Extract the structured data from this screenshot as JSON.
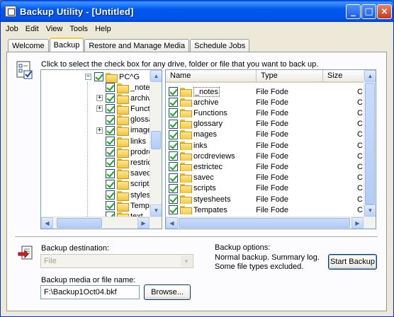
{
  "window": {
    "title": "Backup Utility - [Untitled]",
    "controls": {
      "minimize": "_",
      "maximize": "□",
      "close": "×"
    }
  },
  "menu": [
    "Job",
    "Edit",
    "View",
    "Tools",
    "Help"
  ],
  "tabs": [
    {
      "label": "Welcome",
      "active": false
    },
    {
      "label": "Backup",
      "active": true
    },
    {
      "label": "Restore and Manage Media",
      "active": false
    },
    {
      "label": "Schedule Jobs",
      "active": false
    }
  ],
  "instruction": "Click to select the check box for any drive, folder or file that you want to back up.",
  "tree": {
    "root": {
      "label": "PC^G",
      "expander": "−",
      "checked": true
    },
    "children": [
      {
        "label": "_notes",
        "expander": "",
        "checked": true
      },
      {
        "label": "archive",
        "expander": "+",
        "checked": true
      },
      {
        "label": "Functi",
        "expander": "+",
        "checked": true
      },
      {
        "label": "glossary",
        "expander": "",
        "checked": true
      },
      {
        "label": "images",
        "expander": "+",
        "checked": true
      },
      {
        "label": "links",
        "expander": "",
        "checked": true
      },
      {
        "label": "prodre",
        "expander": "",
        "checked": true
      },
      {
        "label": "restric",
        "expander": "",
        "checked": true
      },
      {
        "label": "saved",
        "expander": "",
        "checked": true
      },
      {
        "label": "scripts",
        "expander": "",
        "checked": true
      },
      {
        "label": "styles",
        "expander": "",
        "checked": true
      },
      {
        "label": "Temp",
        "expander": "",
        "checked": true
      },
      {
        "label": "text",
        "expander": "",
        "checked": true
      }
    ]
  },
  "file_list": {
    "columns": [
      "Name",
      "Type",
      "Size"
    ],
    "rows": [
      {
        "name": "_notes",
        "type": "File Fode",
        "size": "C",
        "checked": true
      },
      {
        "name": "archive",
        "type": "File Fode",
        "size": "C",
        "checked": true
      },
      {
        "name": "Functions",
        "type": "File Fode",
        "size": "C",
        "checked": true
      },
      {
        "name": "glossary",
        "type": "File Fode",
        "size": "C",
        "checked": true
      },
      {
        "name": "mages",
        "type": "File Fode",
        "size": "C",
        "checked": true
      },
      {
        "name": "inks",
        "type": "File Fode",
        "size": "C",
        "checked": true
      },
      {
        "name": "orcdreviews",
        "type": "File Fode",
        "size": "C",
        "checked": true
      },
      {
        "name": "estrictec",
        "type": "File Fode",
        "size": "C",
        "checked": true
      },
      {
        "name": "savec",
        "type": "File Fode",
        "size": "C",
        "checked": true
      },
      {
        "name": "scripts",
        "type": "File Fode",
        "size": "C",
        "checked": true
      },
      {
        "name": "styesheets",
        "type": "File Fode",
        "size": "C",
        "checked": true
      },
      {
        "name": "Tempates",
        "type": "File Fode",
        "size": "C",
        "checked": true
      }
    ]
  },
  "backup_destination": {
    "label": "Backup destination:",
    "value": "File"
  },
  "backup_media": {
    "label": "Backup media or file name:",
    "value": "F:\\Backup1Oct04.bkf"
  },
  "browse_button": "Browse...",
  "backup_options": {
    "label": "Backup options:",
    "line1": "Normal backup.  Summary log.",
    "line2": "Some file types excluded."
  },
  "start_button": "Start Backup"
}
